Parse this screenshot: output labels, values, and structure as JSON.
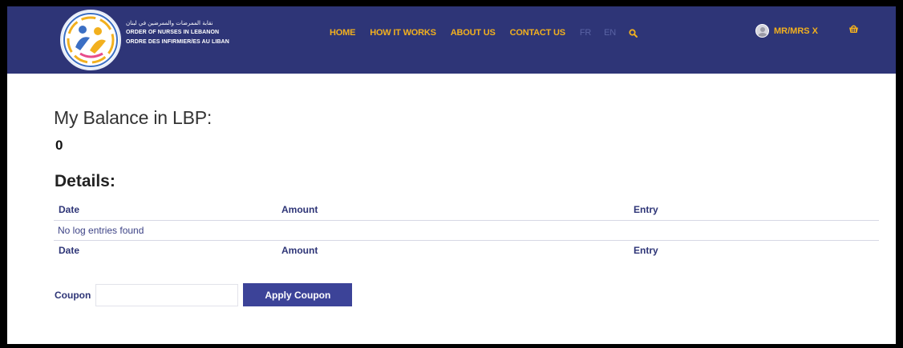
{
  "colors": {
    "header_bg": "#2e3577",
    "nav_link": "#f2b01e",
    "nav_lang_inactive": "#5a63a4",
    "table_text": "#2e3577",
    "button_bg": "#3c4398"
  },
  "header": {
    "logo": {
      "arabic_name": "نقابة الممرضات والممرضين في لبنان",
      "english_name": "ORDER OF NURSES IN LEBANON",
      "french_name": "ORDRE DES INFIRMIER/ES AU LIBAN"
    },
    "nav": {
      "home": "HOME",
      "how_it_works": "HOW IT WORKS",
      "about_us": "ABOUT US",
      "contact_us": "CONTACT US",
      "lang_fr": "FR",
      "lang_en": "EN",
      "search_icon": "search-icon"
    },
    "user": {
      "name": "MR/MRS X",
      "avatar_icon": "user-avatar-icon"
    },
    "cart_icon": "shopping-basket-icon"
  },
  "balance": {
    "title": "My Balance in LBP:",
    "value": "0"
  },
  "details": {
    "title": "Details:",
    "columns": [
      "Date",
      "Amount",
      "Entry"
    ],
    "empty_message": "No log entries found",
    "footer_columns": [
      "Date",
      "Amount",
      "Entry"
    ]
  },
  "coupon": {
    "label": "Coupon",
    "input_value": "",
    "button_label": "Apply Coupon"
  }
}
